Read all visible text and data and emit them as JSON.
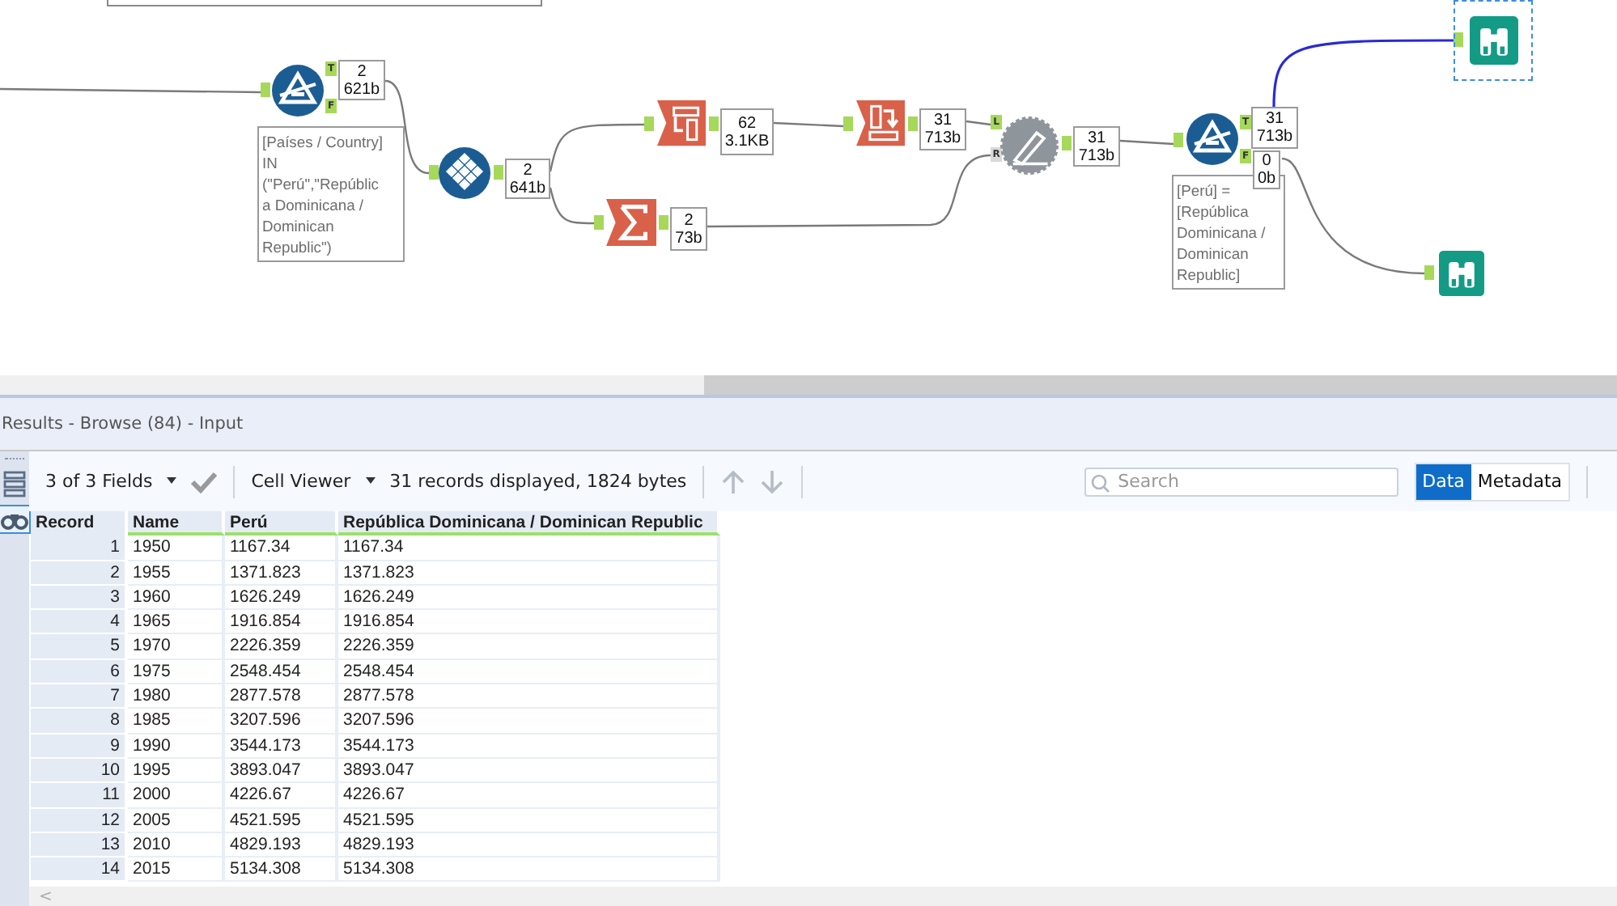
{
  "canvas": {
    "tools": [
      {
        "kind": "filter",
        "selected": false
      },
      {
        "kind": "transpose",
        "selected": false
      },
      {
        "kind": "crosstab",
        "selected": false
      },
      {
        "kind": "sort",
        "selected": false
      },
      {
        "kind": "summarize",
        "selected": false
      },
      {
        "kind": "join",
        "selected": false
      },
      {
        "kind": "filter",
        "selected": false
      },
      {
        "kind": "browse",
        "selected": true
      },
      {
        "kind": "browse",
        "selected": false
      }
    ],
    "counts": [
      {
        "records": "2",
        "size": "621b"
      },
      {
        "records": "2",
        "size": "641b"
      },
      {
        "records": "62",
        "size": "3.1KB"
      },
      {
        "records": "31",
        "size": "713b"
      },
      {
        "records": "2",
        "size": "73b"
      },
      {
        "records": "31",
        "size": "713b"
      },
      {
        "records": "31",
        "size": "713b"
      },
      {
        "records": "0",
        "size": "0b"
      }
    ],
    "anchor_labels": [
      "T",
      "F",
      "L",
      "R",
      "T",
      "F"
    ],
    "connections": [
      {
        "highlighted": false
      },
      {
        "highlighted": false
      },
      {
        "highlighted": false
      },
      {
        "highlighted": false
      },
      {
        "highlighted": false
      },
      {
        "highlighted": false
      },
      {
        "highlighted": false
      },
      {
        "highlighted": false
      },
      {
        "highlighted": true
      },
      {
        "highlighted": false
      }
    ],
    "annotations": [
      {
        "lines": [
          "[Países / Country]",
          "IN",
          "(\"Perú\",\"Repúblic",
          "a Dominicana /",
          "Dominican",
          "Republic\")"
        ]
      },
      {
        "lines": [
          "[Perú] =",
          "[República",
          "Dominicana /",
          "Dominican",
          "Republic]"
        ]
      }
    ]
  },
  "results": {
    "title": "Results - Browse (84) - Input",
    "toolbar": {
      "fields": "3 of 3 Fields",
      "viewer": "Cell Viewer",
      "summary": "31 records displayed, 1824 bytes"
    },
    "search": {
      "placeholder": "Search"
    },
    "view_tabs": [
      {
        "label": "Data",
        "selected": true
      },
      {
        "label": "Metadata",
        "selected": false
      }
    ],
    "table": {
      "columns": [
        "Record",
        "Name",
        "Perú",
        "República Dominicana / Dominican Republic"
      ],
      "rows": [
        [
          "1",
          "1950",
          "1167.34",
          "1167.34"
        ],
        [
          "2",
          "1955",
          "1371.823",
          "1371.823"
        ],
        [
          "3",
          "1960",
          "1626.249",
          "1626.249"
        ],
        [
          "4",
          "1965",
          "1916.854",
          "1916.854"
        ],
        [
          "5",
          "1970",
          "2226.359",
          "2226.359"
        ],
        [
          "6",
          "1975",
          "2548.454",
          "2548.454"
        ],
        [
          "7",
          "1980",
          "2877.578",
          "2877.578"
        ],
        [
          "8",
          "1985",
          "3207.596",
          "3207.596"
        ],
        [
          "9",
          "1990",
          "3544.173",
          "3544.173"
        ],
        [
          "10",
          "1995",
          "3893.047",
          "3893.047"
        ],
        [
          "11",
          "2000",
          "4226.67",
          "4226.67"
        ],
        [
          "12",
          "2005",
          "4521.595",
          "4521.595"
        ],
        [
          "13",
          "2010",
          "4829.193",
          "4829.193"
        ],
        [
          "14",
          "2015",
          "5134.308",
          "5134.308"
        ]
      ]
    },
    "scroll_left": "<"
  }
}
